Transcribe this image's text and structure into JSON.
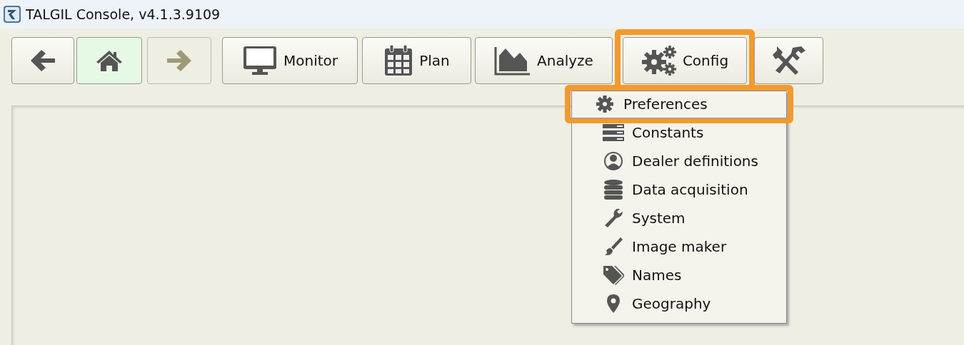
{
  "window": {
    "title": "TALGIL Console, v4.1.3.9109"
  },
  "toolbar": [
    {
      "kind": "back",
      "active": false,
      "disabled": false,
      "highlighted": false
    },
    {
      "kind": "home",
      "active": true,
      "disabled": false,
      "highlighted": false
    },
    {
      "kind": "forward",
      "active": false,
      "disabled": true,
      "highlighted": false
    },
    {
      "kind": "monitor",
      "label": "Monitor",
      "active": false,
      "disabled": false,
      "highlighted": false
    },
    {
      "kind": "plan",
      "label": "Plan",
      "active": false,
      "disabled": false,
      "highlighted": false
    },
    {
      "kind": "analyze",
      "label": "Analyze",
      "active": false,
      "disabled": false,
      "highlighted": false
    },
    {
      "kind": "config",
      "label": "Config",
      "active": false,
      "disabled": false,
      "highlighted": true
    },
    {
      "kind": "tools",
      "active": false,
      "disabled": false,
      "highlighted": false
    }
  ],
  "menu": [
    {
      "kind": "gear",
      "label": "Preferences",
      "highlighted": true
    },
    {
      "kind": "list",
      "label": "Constants",
      "highlighted": false
    },
    {
      "kind": "person",
      "label": "Dealer definitions",
      "highlighted": false
    },
    {
      "kind": "database",
      "label": "Data acquisition",
      "highlighted": false
    },
    {
      "kind": "wrench",
      "label": "System",
      "highlighted": false
    },
    {
      "kind": "brush",
      "label": "Image maker",
      "highlighted": false
    },
    {
      "kind": "tag",
      "label": "Names",
      "highlighted": false
    },
    {
      "kind": "pin",
      "label": "Geography",
      "highlighted": false
    }
  ]
}
